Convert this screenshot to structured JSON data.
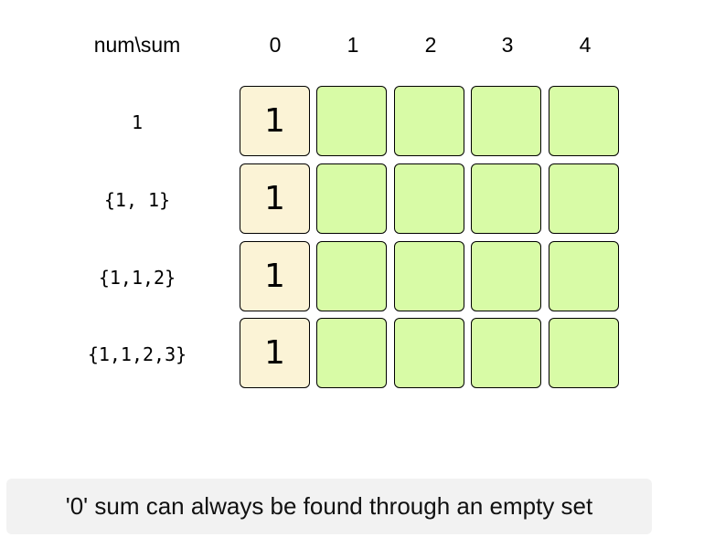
{
  "header": {
    "corner_label": "num\\sum",
    "columns": [
      "0",
      "1",
      "2",
      "3",
      "4"
    ]
  },
  "rows": [
    {
      "label": "1",
      "cells": [
        "1",
        "",
        "",
        "",
        ""
      ]
    },
    {
      "label": "{1, 1}",
      "cells": [
        "1",
        "",
        "",
        "",
        ""
      ]
    },
    {
      "label": "{1,1,2}",
      "cells": [
        "1",
        "",
        "",
        "",
        ""
      ]
    },
    {
      "label": "{1,1,2,3}",
      "cells": [
        "1",
        "",
        "",
        "",
        ""
      ]
    }
  ],
  "caption": "'0' sum can always be found through an empty set",
  "colors": {
    "base_cell": "#fbf3d6",
    "empty_cell": "#d8fba6",
    "caption_bg": "#f2f2f2"
  }
}
